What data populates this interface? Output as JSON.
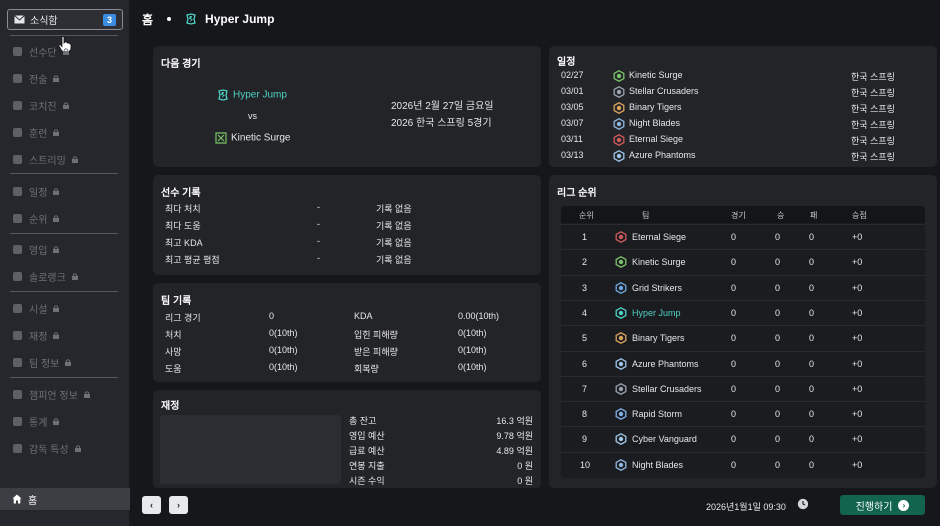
{
  "sidebar": {
    "news": {
      "label": "소식함",
      "badge": "3"
    },
    "items": [
      {
        "label": "선수단",
        "icon": "players-icon"
      },
      {
        "label": "전술",
        "icon": "tactics-icon"
      },
      {
        "label": "코치진",
        "icon": "coach-icon"
      },
      {
        "label": "훈련",
        "icon": "training-icon"
      },
      {
        "label": "스트리밍",
        "icon": "headset-icon"
      },
      {
        "label": "일정",
        "icon": "calendar-icon"
      },
      {
        "label": "순위",
        "icon": "trophy-icon"
      },
      {
        "label": "영입",
        "icon": "recruit-icon"
      },
      {
        "label": "솔로랭크",
        "icon": "solo-rank-icon"
      },
      {
        "label": "시설",
        "icon": "facility-icon"
      },
      {
        "label": "재정",
        "icon": "finance-icon"
      },
      {
        "label": "팀 정보",
        "icon": "team-info-icon"
      },
      {
        "label": "챔피언 정보",
        "icon": "champion-icon"
      },
      {
        "label": "통계",
        "icon": "stats-icon"
      },
      {
        "label": "감독 특성",
        "icon": "manager-icon"
      }
    ],
    "home": {
      "label": "홈"
    }
  },
  "header": {
    "breadcrumb_home": "홈",
    "team": "Hyper Jump"
  },
  "next_match": {
    "title": "다음 경기",
    "home_team": "Hyper Jump",
    "vs": "vs",
    "away_team": "Kinetic Surge",
    "date": "2026년 2월 27일 금요일",
    "event": "2026 한국 스프링 5경기"
  },
  "schedule": {
    "title": "일정",
    "rows": [
      {
        "date": "02/27",
        "team": "Kinetic Surge",
        "league": "한국 스프링",
        "color": "#7cc26a"
      },
      {
        "date": "03/01",
        "team": "Stellar Crusaders",
        "league": "한국 스프링",
        "color": "#9aa3b0"
      },
      {
        "date": "03/05",
        "team": "Binary Tigers",
        "league": "한국 스프링",
        "color": "#d9a35c"
      },
      {
        "date": "03/07",
        "team": "Night Blades",
        "league": "한국 스프링",
        "color": "#8fb6e0"
      },
      {
        "date": "03/11",
        "team": "Eternal Siege",
        "league": "한국 스프링",
        "color": "#d05a5a"
      },
      {
        "date": "03/13",
        "team": "Azure Phantoms",
        "league": "한국 스프링",
        "color": "#9fc4e8"
      }
    ]
  },
  "player_records": {
    "title": "선수 기록",
    "rows": [
      {
        "label": "최다 처치",
        "value": "-",
        "note": "기록 없음"
      },
      {
        "label": "최다 도움",
        "value": "-",
        "note": "기록 없음"
      },
      {
        "label": "최고 KDA",
        "value": "-",
        "note": "기록 없음"
      },
      {
        "label": "최고 평균 평점",
        "value": "-",
        "note": "기록 없음"
      }
    ]
  },
  "team_records": {
    "title": "팀 기록",
    "left": [
      {
        "label": "리그 경기",
        "value": "0"
      },
      {
        "label": "처치",
        "value": "0(10th)"
      },
      {
        "label": "사망",
        "value": "0(10th)"
      },
      {
        "label": "도움",
        "value": "0(10th)"
      }
    ],
    "right": [
      {
        "label": "KDA",
        "value": "0.00(10th)"
      },
      {
        "label": "입힌 피해량",
        "value": "0(10th)"
      },
      {
        "label": "받은 피해량",
        "value": "0(10th)"
      },
      {
        "label": "회복량",
        "value": "0(10th)"
      }
    ]
  },
  "finance": {
    "title": "재정",
    "rows": [
      {
        "label": "총 잔고",
        "value": "16.3 억원"
      },
      {
        "label": "영입 예산",
        "value": "9.78 억원"
      },
      {
        "label": "급료 예산",
        "value": "4.89 억원"
      },
      {
        "label": "연봉 지출",
        "value": "0 원"
      },
      {
        "label": "시즌 수익",
        "value": "0 원"
      }
    ]
  },
  "standings": {
    "title": "리그 순위",
    "headers": {
      "rank": "순위",
      "team": "팀",
      "games": "경기",
      "wins": "승",
      "losses": "패",
      "diff": "승점"
    },
    "rows": [
      {
        "rank": "1",
        "team": "Eternal Siege",
        "games": "0",
        "wins": "0",
        "losses": "0",
        "diff": "+0",
        "color": "#d05a5a"
      },
      {
        "rank": "2",
        "team": "Kinetic Surge",
        "games": "0",
        "wins": "0",
        "losses": "0",
        "diff": "+0",
        "color": "#7cc26a"
      },
      {
        "rank": "3",
        "team": "Grid Strikers",
        "games": "0",
        "wins": "0",
        "losses": "0",
        "diff": "+0",
        "color": "#6fa8dc"
      },
      {
        "rank": "4",
        "team": "Hyper Jump",
        "games": "0",
        "wins": "0",
        "losses": "0",
        "diff": "+0",
        "color": "#4fd1c5",
        "highlight": true
      },
      {
        "rank": "5",
        "team": "Binary Tigers",
        "games": "0",
        "wins": "0",
        "losses": "0",
        "diff": "+0",
        "color": "#d9a35c"
      },
      {
        "rank": "6",
        "team": "Azure Phantoms",
        "games": "0",
        "wins": "0",
        "losses": "0",
        "diff": "+0",
        "color": "#9fc4e8"
      },
      {
        "rank": "7",
        "team": "Stellar Crusaders",
        "games": "0",
        "wins": "0",
        "losses": "0",
        "diff": "+0",
        "color": "#9aa3b0"
      },
      {
        "rank": "8",
        "team": "Rapid Storm",
        "games": "0",
        "wins": "0",
        "losses": "0",
        "diff": "+0",
        "color": "#7fb0e8"
      },
      {
        "rank": "9",
        "team": "Cyber Vanguard",
        "games": "0",
        "wins": "0",
        "losses": "0",
        "diff": "+0",
        "color": "#a0c8e8"
      },
      {
        "rank": "10",
        "team": "Night Blades",
        "games": "0",
        "wins": "0",
        "losses": "0",
        "diff": "+0",
        "color": "#8fb6e0"
      }
    ]
  },
  "footer": {
    "prev": "‹",
    "next": "›",
    "datetime": "2026년1월1일 09:30",
    "proceed": "진행하기"
  },
  "colors": {
    "accent": "#4fd1c5",
    "proceed": "#12644f",
    "badge": "#3a8de0"
  }
}
